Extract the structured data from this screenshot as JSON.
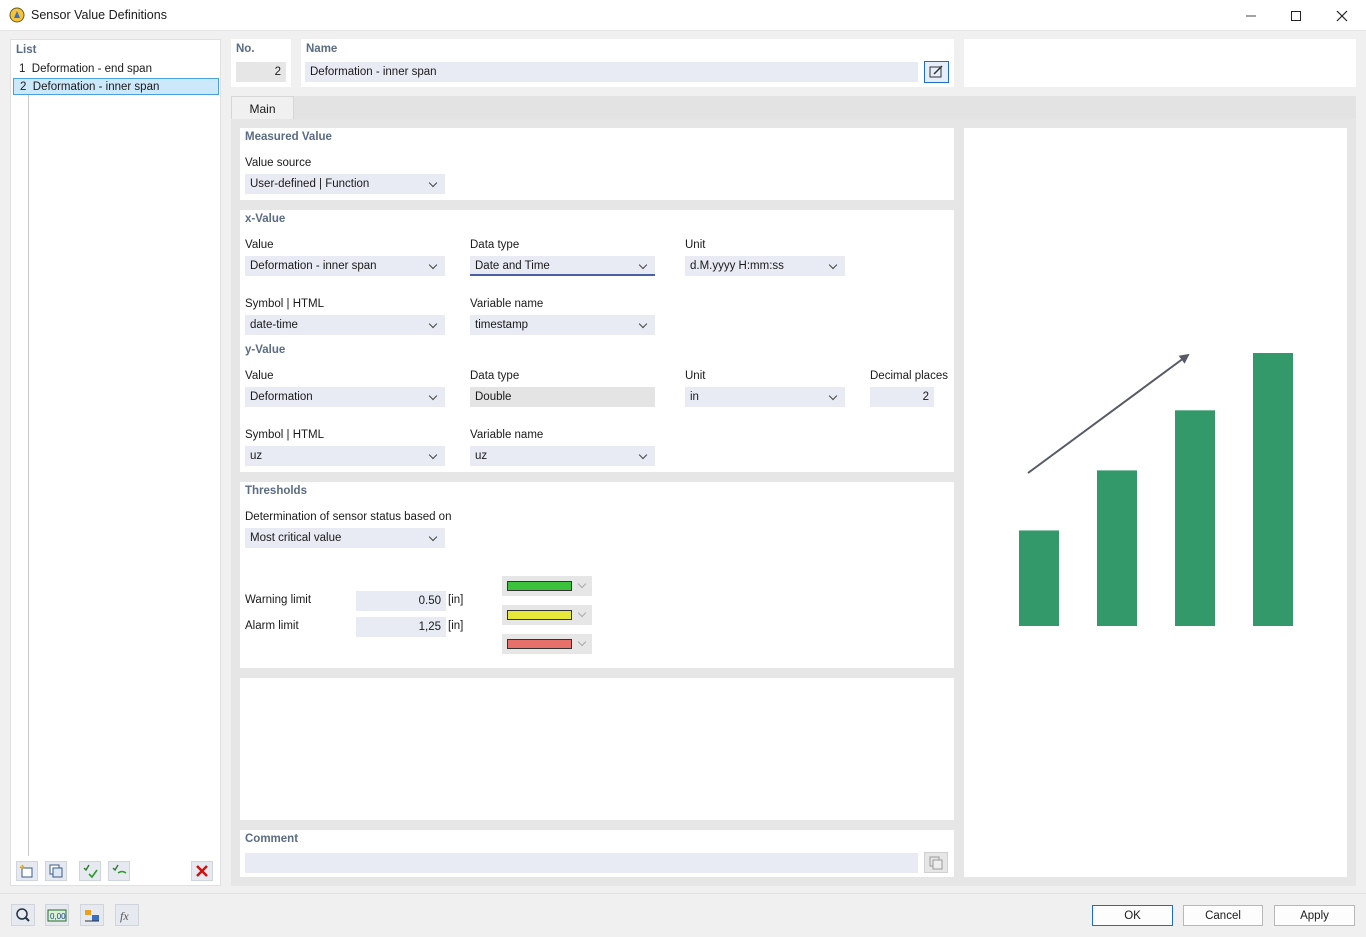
{
  "window": {
    "title": "Sensor Value Definitions"
  },
  "list": {
    "header": "List",
    "items": [
      {
        "no": "1",
        "label": "Deformation - end span"
      },
      {
        "no": "2",
        "label": "Deformation - inner span"
      }
    ],
    "selected_index": 1
  },
  "header": {
    "no_label": "No.",
    "no_value": "2",
    "name_label": "Name",
    "name_value": "Deformation - inner span"
  },
  "tabs": [
    {
      "label": "Main",
      "active": true
    }
  ],
  "measured_value": {
    "title": "Measured Value",
    "value_source_label": "Value source",
    "value_source": "User-defined | Function"
  },
  "x_value": {
    "title": "x-Value",
    "value_label": "Value",
    "value": "Deformation - inner span",
    "data_type_label": "Data type",
    "data_type": "Date and Time",
    "unit_label": "Unit",
    "unit": "d.M.yyyy H:mm:ss",
    "symbol_label": "Symbol | HTML",
    "symbol": "date-time",
    "variable_label": "Variable name",
    "variable": "timestamp"
  },
  "y_value": {
    "title": "y-Value",
    "value_label": "Value",
    "value": "Deformation",
    "data_type_label": "Data type",
    "data_type": "Double",
    "unit_label": "Unit",
    "unit": "in",
    "decimal_label": "Decimal places",
    "decimal": "2",
    "symbol_label": "Symbol | HTML",
    "symbol": "uz",
    "variable_label": "Variable name",
    "variable": "uz"
  },
  "thresholds": {
    "title": "Thresholds",
    "determination_label": "Determination of sensor status based on",
    "determination": "Most critical value",
    "warning_label": "Warning limit",
    "warning_value": "0.50",
    "warning_unit": "[in]",
    "alarm_label": "Alarm limit",
    "alarm_value": "1,25",
    "alarm_unit": "[in]",
    "colors": [
      "#3cc23c",
      "#e8e83a",
      "#e8706a"
    ]
  },
  "comment": {
    "label": "Comment",
    "value": ""
  },
  "buttons": {
    "ok": "OK",
    "cancel": "Cancel",
    "apply": "Apply"
  },
  "icons": {
    "list_tools": [
      "new-item-icon",
      "copy-item-icon",
      "check-all-icon",
      "uncheck-icon",
      "delete-icon"
    ],
    "footer_tools": [
      "help-icon",
      "units-icon",
      "display-icon",
      "function-icon"
    ]
  },
  "preview": {
    "bar_color": "#33996a",
    "arrow_color": "#555a66",
    "relative_heights": [
      0.35,
      0.57,
      0.79,
      1.0
    ]
  }
}
